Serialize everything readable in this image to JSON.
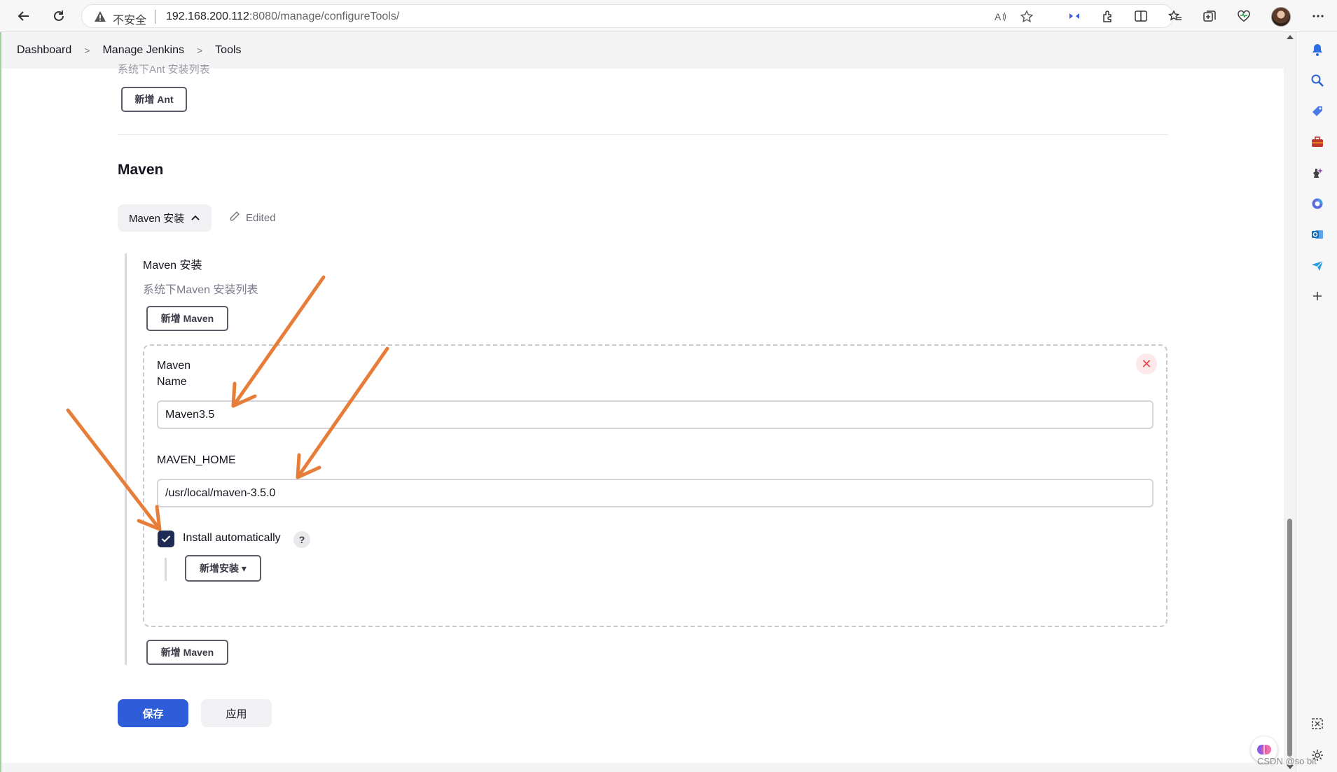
{
  "browser": {
    "insecure_label": "不安全",
    "url_host": "192.168.200.112",
    "url_rest": ":8080/manage/configureTools/"
  },
  "breadcrumb": {
    "items": [
      "Dashboard",
      "Manage Jenkins",
      "Tools"
    ]
  },
  "ant": {
    "cut_text": "系统下Ant 安装列表",
    "add_button": "新增 Ant"
  },
  "maven": {
    "section_title": "Maven",
    "collapse_label": "Maven 安装",
    "edited_label": "Edited",
    "installations_label": "Maven 安装",
    "installations_desc": "系统下Maven 安装列表",
    "add_button_top": "新增 Maven",
    "add_button_bottom": "新增 Maven",
    "entry": {
      "name_label_line1": "Maven",
      "name_label_line2": "Name",
      "name_value": "Maven3.5",
      "home_label": "MAVEN_HOME",
      "home_value": "/usr/local/maven-3.5.0",
      "install_auto_label": "Install automatically",
      "install_auto_checked": true,
      "add_installer_button": "新增安装 ▾"
    }
  },
  "actions": {
    "save": "保存",
    "apply": "应用"
  },
  "watermark": "CSDN @so bit",
  "colors": {
    "primary_button": "#2f5cd8",
    "checkbox": "#1f2a55",
    "annotation_arrow": "#e67e3a"
  }
}
